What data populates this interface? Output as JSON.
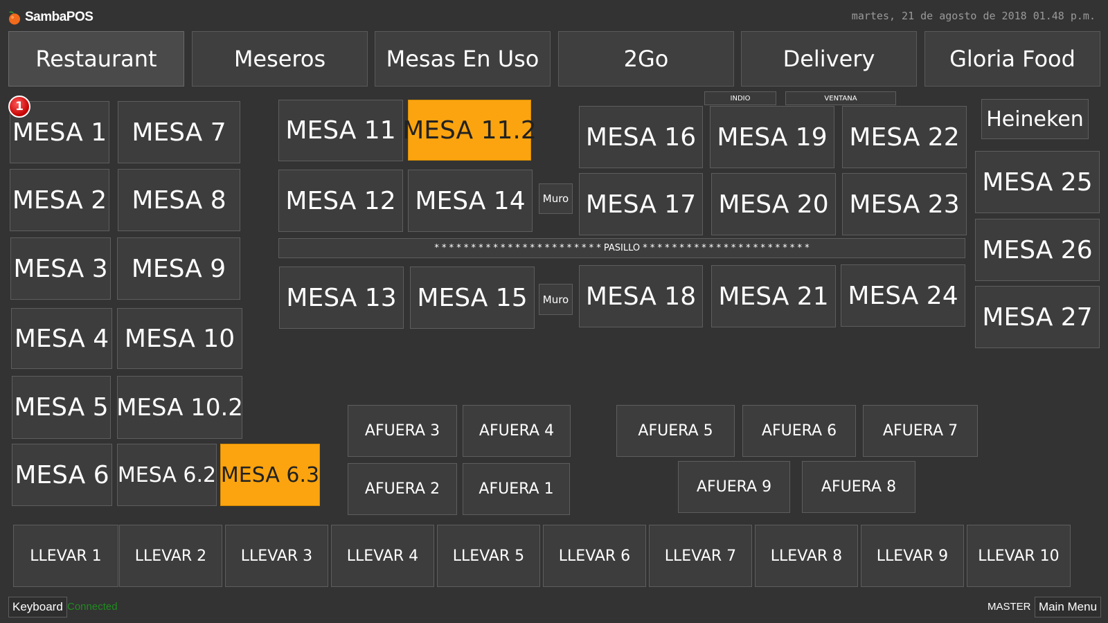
{
  "app": {
    "title": "SambaPOS",
    "datetime": "martes, 21 de agosto de 2018 01.48 p.m."
  },
  "colors": {
    "background": "#333333",
    "occupied": "#fba40f",
    "connected": "#1f8c1f"
  },
  "tabs": [
    "Restaurant",
    "Meseros",
    "Mesas En Uso",
    "2Go",
    "Delivery",
    "Gloria Food"
  ],
  "badge": {
    "count": "1"
  },
  "tables": {
    "mesa_1": "MESA 1",
    "mesa_2": "MESA 2",
    "mesa_3": "MESA 3",
    "mesa_4": "MESA 4",
    "mesa_5": "MESA 5",
    "mesa_6": "MESA 6",
    "mesa_7": "MESA 7",
    "mesa_8": "MESA 8",
    "mesa_9": "MESA 9",
    "mesa_10": "MESA 10",
    "mesa_10_2": "MESA 10.2",
    "mesa_6_2": "MESA 6.2",
    "mesa_6_3": "MESA 6.3",
    "mesa_11": "MESA 11",
    "mesa_11_2": "MESA 11.2",
    "mesa_12": "MESA 12",
    "mesa_14": "MESA 14",
    "mesa_13": "MESA 13",
    "mesa_15": "MESA 15",
    "mesa_16": "MESA 16",
    "mesa_17": "MESA 17",
    "mesa_18": "MESA 18",
    "mesa_19": "MESA 19",
    "mesa_20": "MESA 20",
    "mesa_21": "MESA 21",
    "mesa_22": "MESA 22",
    "mesa_23": "MESA 23",
    "mesa_24": "MESA 24",
    "mesa_25": "MESA 25",
    "mesa_26": "MESA 26",
    "mesa_27": "MESA 27",
    "heineken": "Heineken"
  },
  "labels": {
    "muro": "Muro",
    "indio": "INDIO",
    "ventana": "VENTANA",
    "pasillo": "* * * * * * * * * * * * * * * * * * * * * * * PASILLO * * * * * * * * * * * * * * * * * * * * * * *"
  },
  "afuera": {
    "a1": "AFUERA 1",
    "a2": "AFUERA 2",
    "a3": "AFUERA 3",
    "a4": "AFUERA 4",
    "a5": "AFUERA 5",
    "a6": "AFUERA 6",
    "a7": "AFUERA 7",
    "a8": "AFUERA 8",
    "a9": "AFUERA 9"
  },
  "llevar": [
    "LLEVAR 1",
    "LLEVAR 2",
    "LLEVAR 3",
    "LLEVAR 4",
    "LLEVAR 5",
    "LLEVAR 6",
    "LLEVAR 7",
    "LLEVAR 8",
    "LLEVAR 9",
    "LLEVAR 10"
  ],
  "footer": {
    "keyboard": "Keyboard",
    "status": "Connected",
    "user": "MASTER",
    "main_menu": "Main Menu"
  }
}
